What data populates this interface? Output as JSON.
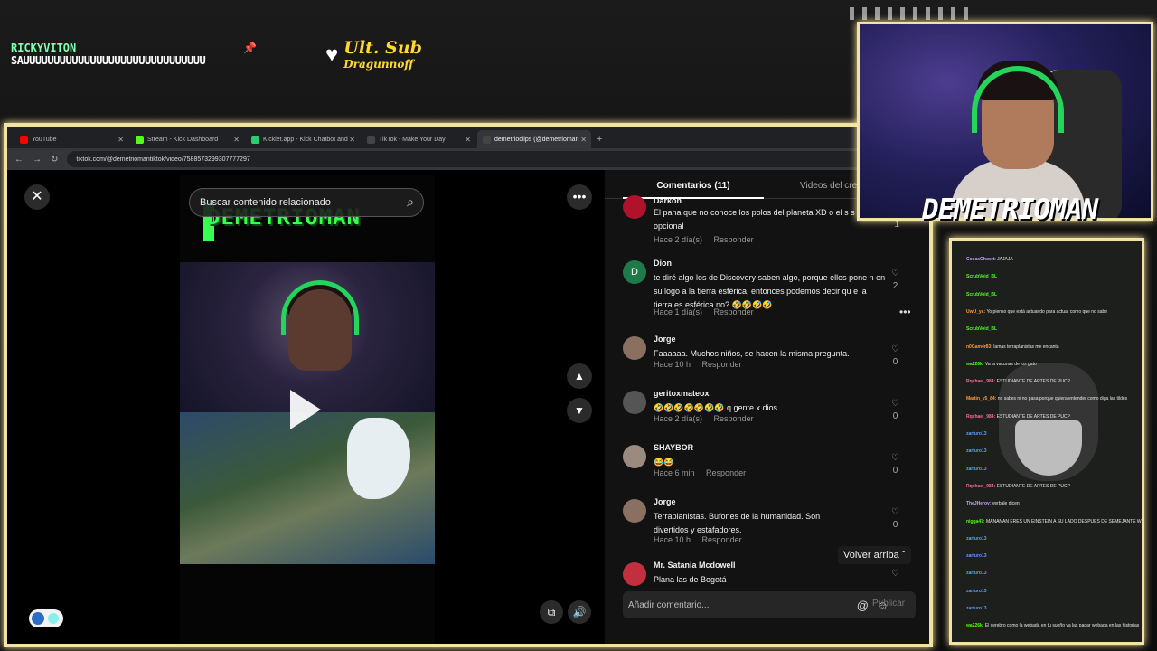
{
  "overlay": {
    "ticker_user": "RICKYVITON",
    "ticker_message": "SAUUUUUUUUUUUUUUUUUUUUUUUUUUUUUU",
    "last_sub_label": "Ult. Sub",
    "last_sub_name": "Dragunnoff",
    "streamer_name": "DEMETRIOMAN"
  },
  "browser": {
    "tabs": [
      {
        "label": "YouTube",
        "color": "#ff0000"
      },
      {
        "label": "Stream - Kick Dashboard",
        "color": "#53fc18"
      },
      {
        "label": "Kicklet.app - Kick Chatbot and",
        "color": "#2ecc71"
      },
      {
        "label": "TikTok - Make Your Day",
        "color": "#111111"
      },
      {
        "label": "demetrioclips (@demetrioman",
        "color": "#111111"
      }
    ],
    "url": "tiktok.com/@demetriomantiktok/video/7588573299307777297"
  },
  "video": {
    "search_placeholder": "Buscar contenido relacionado",
    "overlay_title": "DEMETRIOMAN"
  },
  "comments_panel": {
    "tab_comments": "Comentarios (11)",
    "tab_videos": "Videos del cre",
    "reply_label": "Responder",
    "back_to_top": "Volver arriba",
    "comment_placeholder": "Añadir comentario...",
    "publish_label": "Publicar",
    "comments": [
      {
        "user": "Darkon",
        "text": "El pana que no conoce los polos del planeta XD o el s s opcional",
        "time": "Hace 2 día(s)",
        "likes": "1",
        "avatar_color": "#b0122b"
      },
      {
        "user": "Dion",
        "text": "te diré algo los de Discovery saben algo, porque ellos pone n en su logo a la tierra esférica, entonces podemos decir qu e la tierra es esférica no? 🤣🤣🤣🤣",
        "time": "Hace 1 día(s)",
        "likes": "2",
        "avatar_color": "#1f7a4a",
        "avatar_letter": "D"
      },
      {
        "user": "Jorge",
        "text": "Faaaaaa. Muchos niños, se hacen la misma pregunta.",
        "time": "Hace 10 h",
        "likes": "0",
        "avatar_color": "#8a7060"
      },
      {
        "user": "geritoxmateox",
        "text": "🤣🤣🤣🤣🤣🤣🤣 q gente x dios",
        "time": "Hace 2 día(s)",
        "likes": "0",
        "avatar_color": "#555555"
      },
      {
        "user": "SHAYBOR",
        "text": "😂😂",
        "time": "Hace 6 min",
        "likes": "0",
        "avatar_color": "#9a8a80"
      },
      {
        "user": "Jorge",
        "text": "Terraplanistas. Bufones de la humanidad. Son divertidos y estafadores.",
        "time": "Hace 10 h",
        "likes": "0",
        "avatar_color": "#8a7060"
      },
      {
        "user": "Mr. Satania Mcdowell",
        "text": "Plana las de Bogotá",
        "time": "",
        "likes": "",
        "avatar_color": "#c23040"
      }
    ]
  },
  "chat": {
    "messages": [
      {
        "user": "CosasGhostt:",
        "text": "JAJAJA",
        "color": "#c8a0ff"
      },
      {
        "user": "ScrubVoid_BL",
        "text": "",
        "color": "#53fc18"
      },
      {
        "user": "ScrubVoid_BL",
        "text": "",
        "color": "#53fc18"
      },
      {
        "user": "UwU_ya:",
        "text": "Yo pienso que está actuando para actuar como que no sabe",
        "color": "#ff9a3c"
      },
      {
        "user": "ScrubVoid_BL",
        "text": "",
        "color": "#53fc18"
      },
      {
        "user": "n0Gam4r83:",
        "text": "lamas terraplanistas me encanta",
        "color": "#ff9a3c"
      },
      {
        "user": "wa226k:",
        "text": "Va la vacunas de los gato",
        "color": "#53fc18"
      },
      {
        "user": "Rqchael_984:",
        "text": "ESTUDIANTE DE ARTES DE PUCP",
        "color": "#ff6b9d"
      },
      {
        "user": "Martin_v5_84:",
        "text": "no sabes ni no pasa porque quiera entender como diga las tildes",
        "color": "#ff9a3c"
      },
      {
        "user": "Rqchael_984:",
        "text": "ESTUDIANTE DE ARTES DE PUCP",
        "color": "#ff6b9d"
      },
      {
        "user": "zarfuro13",
        "text": "",
        "color": "#5aa0ff"
      },
      {
        "user": "zarfuro13",
        "text": "",
        "color": "#5aa0ff"
      },
      {
        "user": "zarfuro13",
        "text": "",
        "color": "#5aa0ff"
      },
      {
        "user": "Rqchael_984:",
        "text": "ESTUDIANTE DE ARTES DE PUCP",
        "color": "#ff6b9d"
      },
      {
        "user": "TheJHeroy:",
        "text": "verbale dicen",
        "color": "#c8a0ff"
      },
      {
        "user": "nigga47:",
        "text": "MANANAN ERES UN EINSTEIN A SU LADO DESPUES DE SEMEJANTE WEBADA",
        "color": "#53fc18"
      },
      {
        "user": "zarfuro13",
        "text": "",
        "color": "#5aa0ff"
      },
      {
        "user": "zarfuro13",
        "text": "",
        "color": "#5aa0ff"
      },
      {
        "user": "zarfuro13",
        "text": "",
        "color": "#5aa0ff"
      },
      {
        "user": "zarfuro13",
        "text": "",
        "color": "#5aa0ff"
      },
      {
        "user": "zarfuro13",
        "text": "",
        "color": "#5aa0ff"
      },
      {
        "user": "wa226k:",
        "text": "El cerebro como la webada en tu sueño ya las pagar webada en las historias",
        "color": "#53fc18"
      }
    ]
  }
}
